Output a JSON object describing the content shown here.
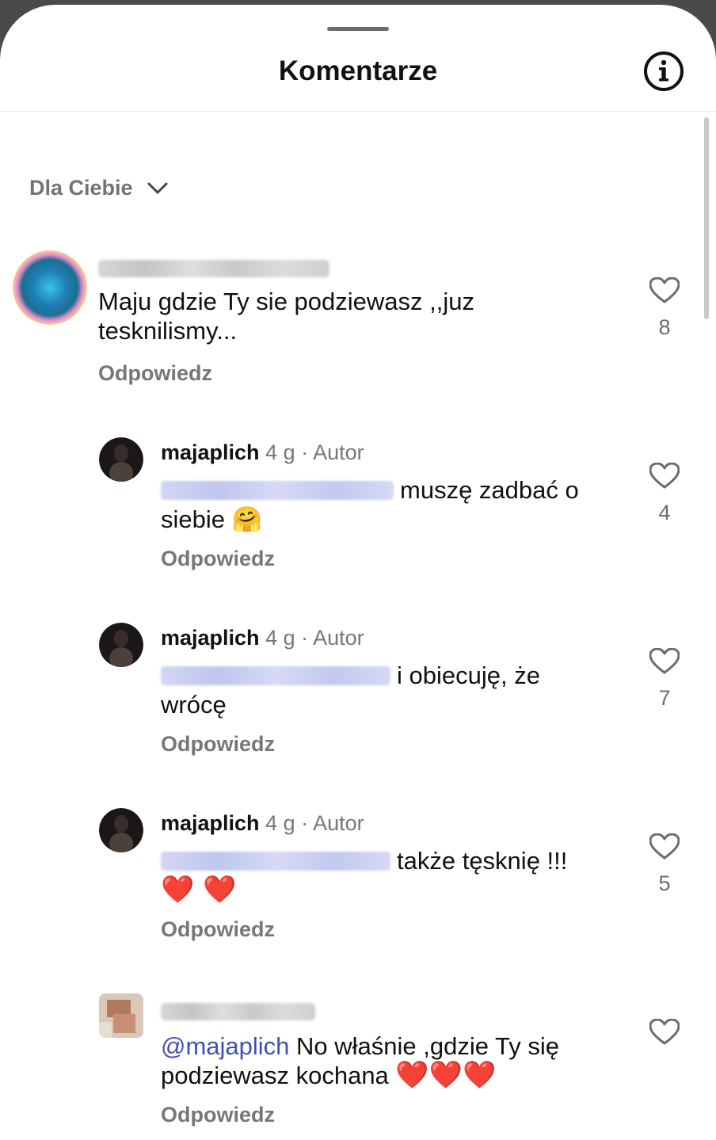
{
  "header": {
    "title": "Komentarze",
    "info_icon": "info-icon"
  },
  "sort": {
    "label": "Dla Ciebie",
    "icon": "chevron-down-icon"
  },
  "comments": [
    {
      "username": "",
      "body": "Maju gdzie Ty sie podziewasz ,,juz tesknilismy...",
      "reply_label": "Odpowiedz",
      "likes": "8"
    },
    {
      "username": "majaplich",
      "time": "4 g",
      "separator": "·",
      "author_label": "Autor",
      "body": "muszę zadbać o siebie",
      "emoji": "🤗",
      "reply_label": "Odpowiedz",
      "likes": "4"
    },
    {
      "username": "majaplich",
      "time": "4 g",
      "separator": "·",
      "author_label": "Autor",
      "body": "i obiecuję, że wrócę",
      "reply_label": "Odpowiedz",
      "likes": "7"
    },
    {
      "username": "majaplich",
      "time": "4 g",
      "separator": "·",
      "author_label": "Autor",
      "body": "także tęsknię !!!",
      "emoji": "❤️ ❤️",
      "reply_label": "Odpowiedz",
      "likes": "5"
    },
    {
      "username": "",
      "mention": "@majaplich",
      "body": "No właśnie ,gdzie Ty się podziewasz kochana",
      "emoji": "❤️❤️❤️",
      "reply_label": "Odpowiedz",
      "likes": ""
    }
  ],
  "colors": {
    "mention": "#3f51b5",
    "secondary_text": "#777777",
    "heart_emoji": "#e0162b"
  }
}
